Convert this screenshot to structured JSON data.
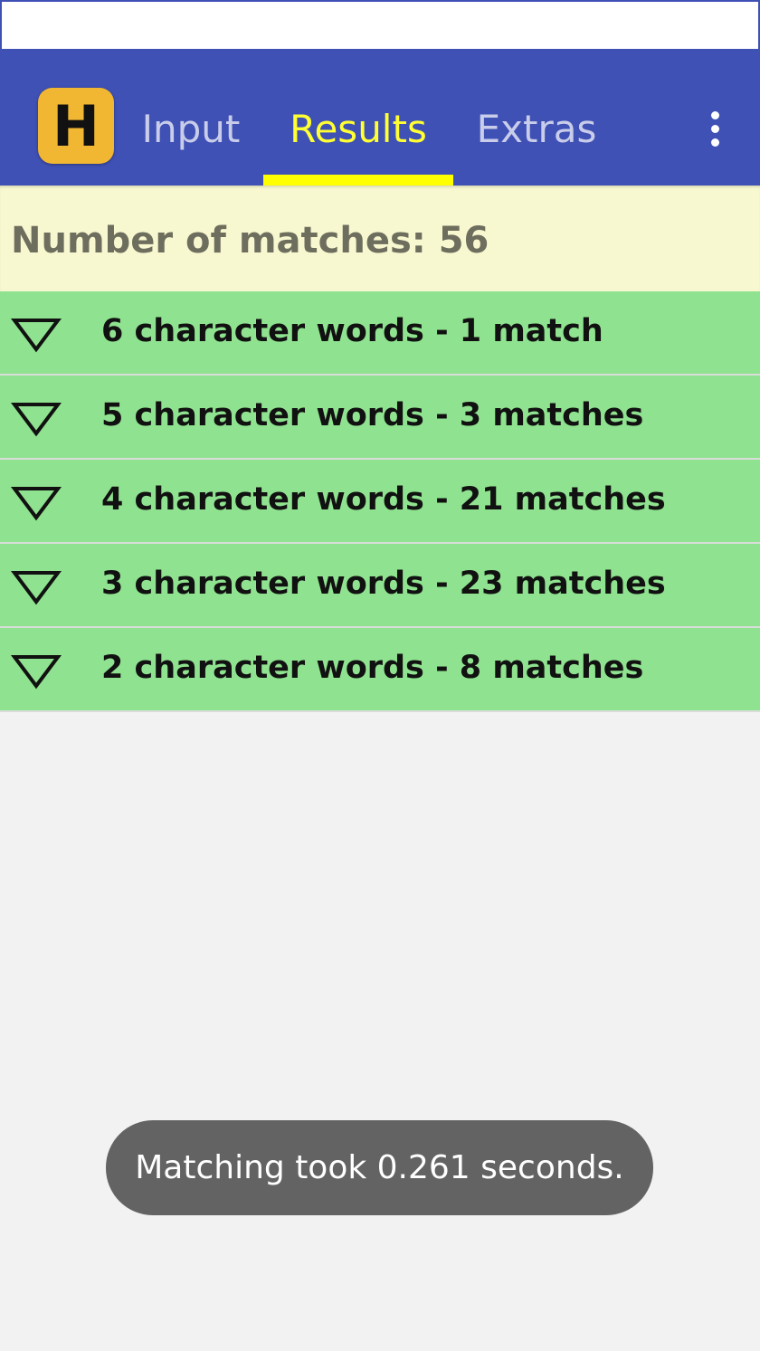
{
  "app": {
    "logo_letter": "H",
    "logo_color": "#f2b732",
    "bar_color": "#3f51b5"
  },
  "tabs": [
    {
      "label": "Input",
      "active": false
    },
    {
      "label": "Results",
      "active": true
    },
    {
      "label": "Extras",
      "active": false
    }
  ],
  "menu_icon": "more-vert-icon",
  "summary": {
    "text": "Number of matches: 56"
  },
  "groups": [
    {
      "label": "6 character words - 1 match",
      "icon": "expand-triangle-icon"
    },
    {
      "label": "5 character words - 3 matches",
      "icon": "expand-triangle-icon"
    },
    {
      "label": "4 character words - 21 matches",
      "icon": "expand-triangle-icon"
    },
    {
      "label": "3 character words - 23 matches",
      "icon": "expand-triangle-icon"
    },
    {
      "label": "2 character words - 8 matches",
      "icon": "expand-triangle-icon"
    }
  ],
  "toast": {
    "text": "Matching took 0.261 seconds."
  },
  "colors": {
    "active_tab": "#ffff33",
    "inactive_tab": "#c9cdea",
    "summary_bg": "#f8f8d0",
    "group_bg": "#8fe28f",
    "toast_bg": "#636363"
  }
}
